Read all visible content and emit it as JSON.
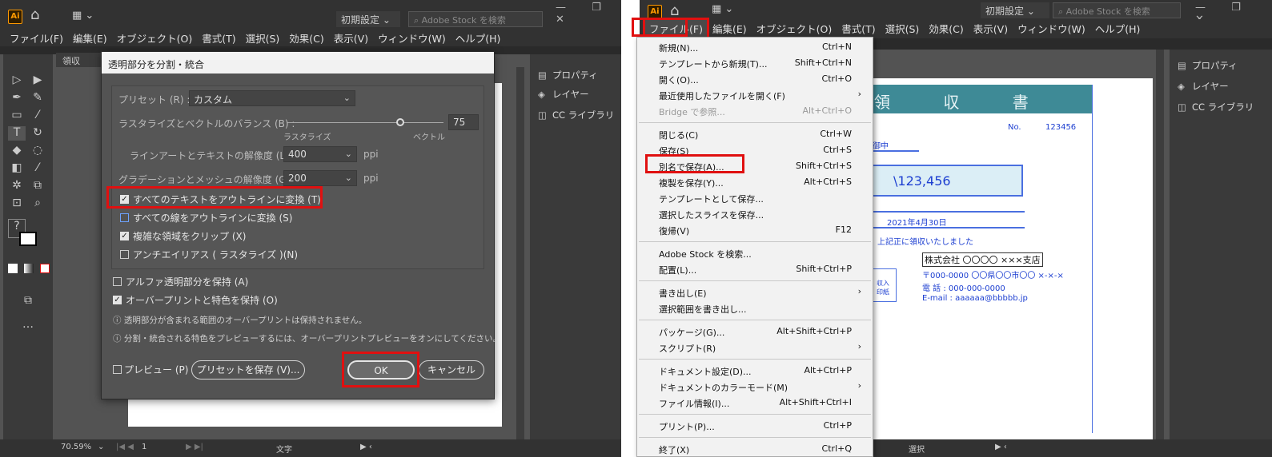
{
  "common": {
    "app_logo": "Ai",
    "home_icon": "home-icon",
    "workspace_preset": "初期設定",
    "search_placeholder": "Adobe Stock を検索",
    "window_controls": "— ❐ ✕",
    "menu": [
      "ファイル(F)",
      "編集(E)",
      "オブジェクト(O)",
      "書式(T)",
      "選択(S)",
      "効果(C)",
      "表示(V)",
      "ウィンドウ(W)",
      "ヘルプ(H)"
    ],
    "panels": [
      {
        "icon": "properties-icon",
        "label": "プロパティ"
      },
      {
        "icon": "layers-icon",
        "label": "レイヤー"
      },
      {
        "icon": "cc-libraries-icon",
        "label": "CC ライブラリ"
      }
    ]
  },
  "left": {
    "doc_tab": "領収書.pd",
    "zoom": "70.59%",
    "artboard_no": "1",
    "status_tool": "文字",
    "dialog": {
      "title": "透明部分を分割・統合",
      "preset_label": "プリセット (R) :",
      "preset_value": "カスタム",
      "balance_label": "ラスタライズとベクトルのバランス (B) :",
      "balance_left": "ラスタライズ",
      "balance_right": "ベクトル",
      "balance_value": "75",
      "line_res_label": "ラインアートとテキストの解像度 (L) :",
      "line_res_value": "400",
      "grad_res_label": "グラデーションとメッシュの解像度 (G) :",
      "grad_res_value": "200",
      "ppi": "ppi",
      "cb_text_outline": "すべてのテキストをアウトラインに変換 (T)",
      "cb_stroke_outline": "すべての線をアウトラインに変換 (S)",
      "cb_clip": "複雑な領域をクリップ (X)",
      "cb_antialias": "アンチエイリアス ( ラスタライズ )(N)",
      "cb_alpha": "アルファ透明部分を保持 (A)",
      "cb_overprint": "オーバープリントと特色を保持 (O)",
      "note1": "透明部分が含まれる範囲のオーバープリントは保持されません。",
      "note2": "分割・統合される特色をプレビューするには、オーバープリントプレビューをオンにしてください。",
      "cb_preview": "プレビュー (P)",
      "save_preset_btn": "プリセットを保存 (V)...",
      "ok_btn": "OK",
      "cancel_btn": "キャンセル"
    }
  },
  "right": {
    "status_tool": "選択",
    "file_menu": [
      {
        "label": "新規(N)...",
        "shortcut": "Ctrl+N"
      },
      {
        "label": "テンプレートから新規(T)...",
        "shortcut": "Shift+Ctrl+N"
      },
      {
        "label": "開く(O)...",
        "shortcut": "Ctrl+O"
      },
      {
        "label": "最近使用したファイルを開く(F)",
        "shortcut": ""
      },
      {
        "label": "Bridge で参照...",
        "shortcut": "Alt+Ctrl+O"
      },
      {
        "label": "閉じる(C)",
        "shortcut": "Ctrl+W"
      },
      {
        "label": "保存(S)",
        "shortcut": "Ctrl+S"
      },
      {
        "label": "別名で保存(A)...",
        "shortcut": "Shift+Ctrl+S"
      },
      {
        "label": "複製を保存(Y)...",
        "shortcut": "Alt+Ctrl+S"
      },
      {
        "label": "テンプレートとして保存...",
        "shortcut": ""
      },
      {
        "label": "選択したスライスを保存...",
        "shortcut": ""
      },
      {
        "label": "復帰(V)",
        "shortcut": "F12"
      },
      {
        "label": "Adobe Stock を検索...",
        "shortcut": ""
      },
      {
        "label": "配置(L)...",
        "shortcut": "Shift+Ctrl+P"
      },
      {
        "label": "書き出し(E)",
        "shortcut": ""
      },
      {
        "label": "選択範囲を書き出し...",
        "shortcut": ""
      },
      {
        "label": "パッケージ(G)...",
        "shortcut": "Alt+Shift+Ctrl+P"
      },
      {
        "label": "スクリプト(R)",
        "shortcut": ""
      },
      {
        "label": "ドキュメント設定(D)...",
        "shortcut": "Alt+Ctrl+P"
      },
      {
        "label": "ドキュメントのカラーモード(M)",
        "shortcut": ""
      },
      {
        "label": "ファイル情報(I)...",
        "shortcut": "Alt+Shift+Ctrl+I"
      },
      {
        "label": "プリント(P)...",
        "shortcut": "Ctrl+P"
      },
      {
        "label": "終了(X)",
        "shortcut": "Ctrl+Q"
      }
    ],
    "receipt": {
      "title": "領 収 書",
      "no_label": "No.",
      "no_value": "123456",
      "addressee": "御中",
      "amount": "\\123,456",
      "date": "2021年4月30日",
      "received": "上記正に領収いたしました",
      "company": "株式会社 〇〇〇〇 ×××支店",
      "address": "〒000-0000 〇〇県〇〇市〇〇 ×-×-×",
      "tel": "電 話 : 000-000-0000",
      "email": "E-mail : aaaaaa@bbbbb.jp",
      "stamp": "収入印紙"
    }
  }
}
